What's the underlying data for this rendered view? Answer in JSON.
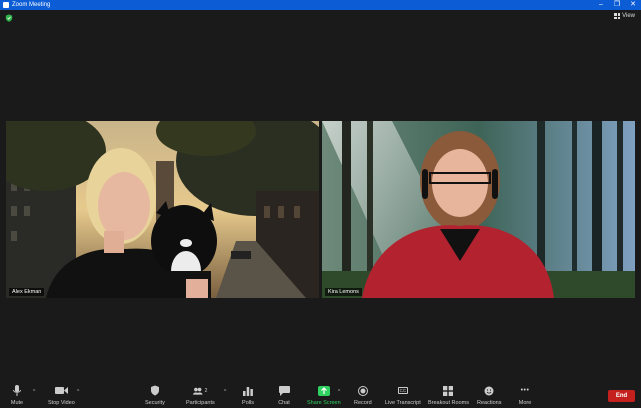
{
  "window": {
    "title": "Zoom Meeting",
    "minimize": "–",
    "maximize": "❐",
    "close": "✕"
  },
  "header": {
    "view_label": "View"
  },
  "participants": [
    {
      "name": "Alex Ekman"
    },
    {
      "name": "Kira Lemons"
    }
  ],
  "toolbar": {
    "mute": "Mute",
    "stop_video": "Stop Video",
    "security": "Security",
    "participants": "Participants",
    "participants_count": "2",
    "polls": "Polls",
    "chat": "Chat",
    "share_screen": "Share Screen",
    "record": "Record",
    "live_transcript": "Live Transcript",
    "cc_icon_text": "CC",
    "breakout_rooms": "Breakout Rooms",
    "reactions": "Reactions",
    "more": "More",
    "more_glyph": "•••",
    "caret": "^",
    "end": "End"
  },
  "colors": {
    "titlebar": "#0b5cd5",
    "background": "#1a1a1a",
    "end": "#c4201e",
    "share": "#2fd160"
  }
}
